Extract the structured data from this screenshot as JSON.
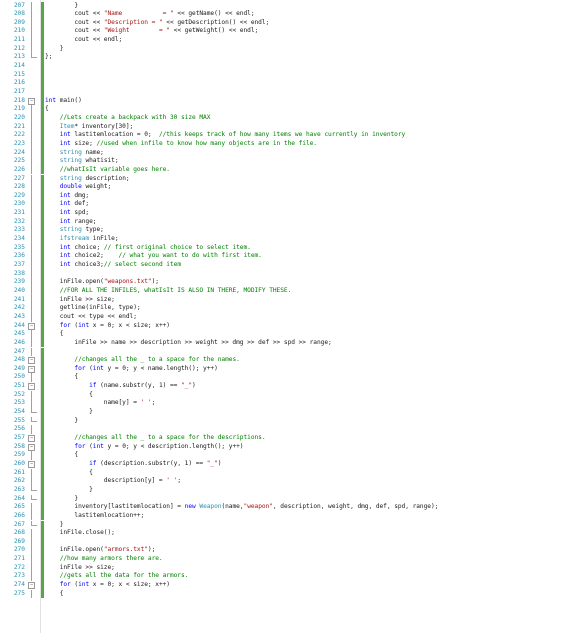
{
  "editor": {
    "colors": {
      "keyword": "#0000ff",
      "type": "#2b91af",
      "comment": "#008000",
      "string": "#a31515",
      "text": "#1a1a1a",
      "line_number": "#2b91af",
      "change_marker": "#57a64a"
    },
    "lines": [
      {
        "n": "207",
        "text": "        }",
        "fold": "line"
      },
      {
        "n": "208",
        "text": "        cout << \"Name           = \" << getName() << endl;",
        "fold": "line"
      },
      {
        "n": "209",
        "text": "        cout << \"Description = \" << getDescription() << endl;",
        "fold": "line"
      },
      {
        "n": "210",
        "text": "        cout << \"Weight        = \" << getWeight() << endl;",
        "fold": "line"
      },
      {
        "n": "211",
        "text": "        cout << endl;",
        "fold": "line"
      },
      {
        "n": "212",
        "text": "    }",
        "fold": "line"
      },
      {
        "n": "213",
        "text": "};",
        "fold": "end"
      },
      {
        "n": "214",
        "text": "",
        "fold": ""
      },
      {
        "n": "215",
        "text": "",
        "fold": ""
      },
      {
        "n": "216",
        "text": "",
        "fold": ""
      },
      {
        "n": "217",
        "text": "",
        "fold": ""
      },
      {
        "n": "218",
        "text": "int main()",
        "fold": "box"
      },
      {
        "n": "219",
        "text": "{",
        "fold": "line"
      },
      {
        "n": "220",
        "text": "    //Lets create a backpack with 30 size MAX",
        "fold": "line"
      },
      {
        "n": "221",
        "text": "    Item* inventory[30];",
        "fold": "line"
      },
      {
        "n": "222",
        "text": "    int lastitemlocation = 0;  //this keeps track of how many items we have currently in inventory",
        "fold": "line"
      },
      {
        "n": "223",
        "text": "    int size; //used when infile to know how many objects are in the file.",
        "fold": "line"
      },
      {
        "n": "224",
        "text": "    string name;",
        "fold": "line"
      },
      {
        "n": "225",
        "text": "    string whatisit;",
        "fold": "line"
      },
      {
        "n": "226",
        "text": "    //whatIsIt variable goes here.",
        "fold": "line"
      },
      {
        "n": "227",
        "text": "    string description;",
        "fold": "line"
      },
      {
        "n": "228",
        "text": "    double weight;",
        "fold": "line"
      },
      {
        "n": "229",
        "text": "    int dmg;",
        "fold": "line"
      },
      {
        "n": "230",
        "text": "    int def;",
        "fold": "line"
      },
      {
        "n": "231",
        "text": "    int spd;",
        "fold": "line"
      },
      {
        "n": "232",
        "text": "    int range;",
        "fold": "line"
      },
      {
        "n": "233",
        "text": "    string type;",
        "fold": "line"
      },
      {
        "n": "234",
        "text": "    ifstream inFile;",
        "fold": "line"
      },
      {
        "n": "235",
        "text": "    int choice; // first original choice to select item.",
        "fold": "line"
      },
      {
        "n": "236",
        "text": "    int choice2;    // what you want to do with first item.",
        "fold": "line"
      },
      {
        "n": "237",
        "text": "    int choice3;// select second item",
        "fold": "line"
      },
      {
        "n": "238",
        "text": "",
        "fold": "line"
      },
      {
        "n": "239",
        "text": "    inFile.open(\"weapons.txt\");",
        "fold": "line"
      },
      {
        "n": "240",
        "text": "    //FOR ALL THE INFILES, whatIsIt IS ALSO IN THERE, MODIFY THESE.",
        "fold": "line"
      },
      {
        "n": "241",
        "text": "    inFile >> size;",
        "fold": "line"
      },
      {
        "n": "242",
        "text": "    getline(inFile, type);",
        "fold": "line"
      },
      {
        "n": "243",
        "text": "    cout << type << endl;",
        "fold": "line"
      },
      {
        "n": "244",
        "text": "    for (int x = 0; x < size; x++)",
        "fold": "box"
      },
      {
        "n": "245",
        "text": "    {",
        "fold": "line"
      },
      {
        "n": "246",
        "text": "        inFile >> name >> description >> weight >> dmg >> def >> spd >> range;",
        "fold": "line"
      },
      {
        "n": "247",
        "text": "",
        "fold": "line"
      },
      {
        "n": "248",
        "text": "        //changes all the _ to a space for the names.",
        "fold": "box"
      },
      {
        "n": "249",
        "text": "        for (int y = 0; y < name.length(); y++)",
        "fold": "box"
      },
      {
        "n": "250",
        "text": "        {",
        "fold": "line"
      },
      {
        "n": "251",
        "text": "            if (name.substr(y, 1) == \"_\")",
        "fold": "box"
      },
      {
        "n": "252",
        "text": "            {",
        "fold": "line"
      },
      {
        "n": "253",
        "text": "                name[y] = ' ';",
        "fold": "line"
      },
      {
        "n": "254",
        "text": "            }",
        "fold": "end"
      },
      {
        "n": "255",
        "text": "        }",
        "fold": "end"
      },
      {
        "n": "256",
        "text": "",
        "fold": "line"
      },
      {
        "n": "257",
        "text": "        //changes all the _ to a space for the descriptions.",
        "fold": "box"
      },
      {
        "n": "258",
        "text": "        for (int y = 0; y < description.length(); y++)",
        "fold": "box"
      },
      {
        "n": "259",
        "text": "        {",
        "fold": "line"
      },
      {
        "n": "260",
        "text": "            if (description.substr(y, 1) == \"_\")",
        "fold": "box"
      },
      {
        "n": "261",
        "text": "            {",
        "fold": "line"
      },
      {
        "n": "262",
        "text": "                description[y] = ' ';",
        "fold": "line"
      },
      {
        "n": "263",
        "text": "            }",
        "fold": "end"
      },
      {
        "n": "264",
        "text": "        }",
        "fold": "end"
      },
      {
        "n": "265",
        "text": "        inventory[lastitemlocation] = new Weapon(name,\"weapon\", description, weight, dmg, def, spd, range);",
        "fold": "line"
      },
      {
        "n": "266",
        "text": "        lastitemlocation++;",
        "fold": "line"
      },
      {
        "n": "267",
        "text": "    }",
        "fold": "end"
      },
      {
        "n": "268",
        "text": "    inFile.close();",
        "fold": "line"
      },
      {
        "n": "269",
        "text": "",
        "fold": "line"
      },
      {
        "n": "270",
        "text": "    inFile.open(\"armors.txt\");",
        "fold": "line"
      },
      {
        "n": "271",
        "text": "    //how many armors there are.",
        "fold": "line"
      },
      {
        "n": "272",
        "text": "    inFile >> size;",
        "fold": "line"
      },
      {
        "n": "273",
        "text": "    //gets all the data for the armors.",
        "fold": "line"
      },
      {
        "n": "274",
        "text": "    for (int x = 0; x < size; x++)",
        "fold": "box"
      },
      {
        "n": "275",
        "text": "    {",
        "fold": "line"
      }
    ]
  }
}
